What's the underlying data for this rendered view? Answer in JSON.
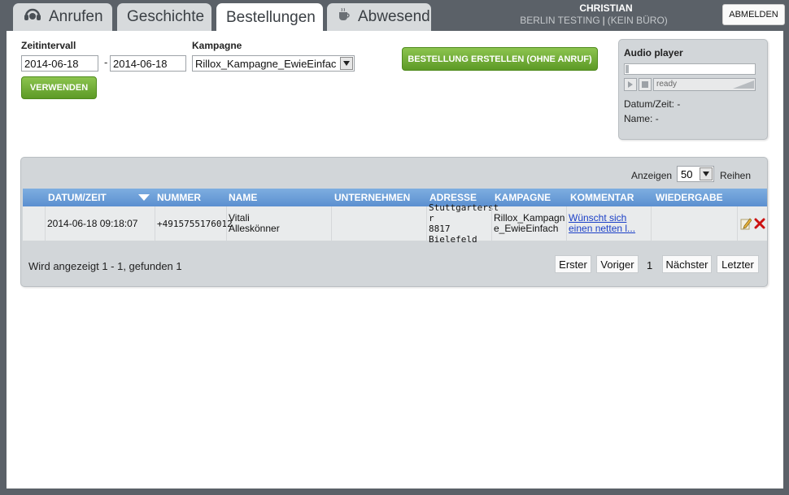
{
  "tabs": [
    {
      "label": "Anrufen",
      "icon": "headset-icon"
    },
    {
      "label": "Geschichte",
      "icon": ""
    },
    {
      "label": "Bestellungen",
      "icon": "",
      "active": true
    },
    {
      "label": "Abwesend",
      "icon": "coffee-cup-icon"
    }
  ],
  "user": {
    "name": "CHRISTIAN",
    "location": "BERLIN TESTING",
    "separator": "|",
    "office": "(KEIN BÜRO)"
  },
  "logout_label": "ABMELDEN",
  "filters": {
    "time_label": "Zeitintervall",
    "date_from": "2014-06-18",
    "date_separator": "-",
    "date_to": "2014-06-18",
    "campaign_label": "Kampagne",
    "campaign_value": "Rillox_Kampagne_EwieEinfac",
    "apply_label": "VERWENDEN"
  },
  "create_order_label": "BESTELLUNG ERSTELLEN (OHNE ANRUF)",
  "audio": {
    "title": "Audio player",
    "status": "ready",
    "datetime_label": "Datum/Zeit:",
    "datetime_value": "-",
    "name_label": "Name:",
    "name_value": "-"
  },
  "grid": {
    "show_label": "Anzeigen",
    "page_size": "50",
    "rows_label": "Reihen",
    "columns": [
      "DATUM/ZEIT",
      "NUMMER",
      "NAME",
      "UNTERNEHMEN",
      "ADRESSE",
      "KAMPAGNE",
      "KOMMENTAR",
      "WIEDERGABE"
    ],
    "rows": [
      {
        "datetime": "2014-06-18 09:18:07",
        "number": "+4915755176012",
        "name_line1": "Vitali",
        "name_line2": "Alleskönner",
        "company": "",
        "address_line1": "Stuttgarterst",
        "address_line2": "r",
        "address_line3": "8817 Bielefeld",
        "campaign_line1": "Rillox_Kampagn",
        "campaign_line2": "e_EwieEinfach",
        "comment_line1": "Wünscht sich",
        "comment_line2": "einen netten l..."
      }
    ],
    "summary": "Wird angezeigt 1 - 1, gefunden 1",
    "pager": {
      "first": "Erster",
      "prev": "Voriger",
      "current": "1",
      "next": "Nächster",
      "last": "Letzter"
    }
  },
  "colors": {
    "background": "#5b6168",
    "header_blue": "#6b9dd8",
    "green_button": "#6faa34",
    "link": "#1a3fc7",
    "delete_red": "#cc1111"
  }
}
